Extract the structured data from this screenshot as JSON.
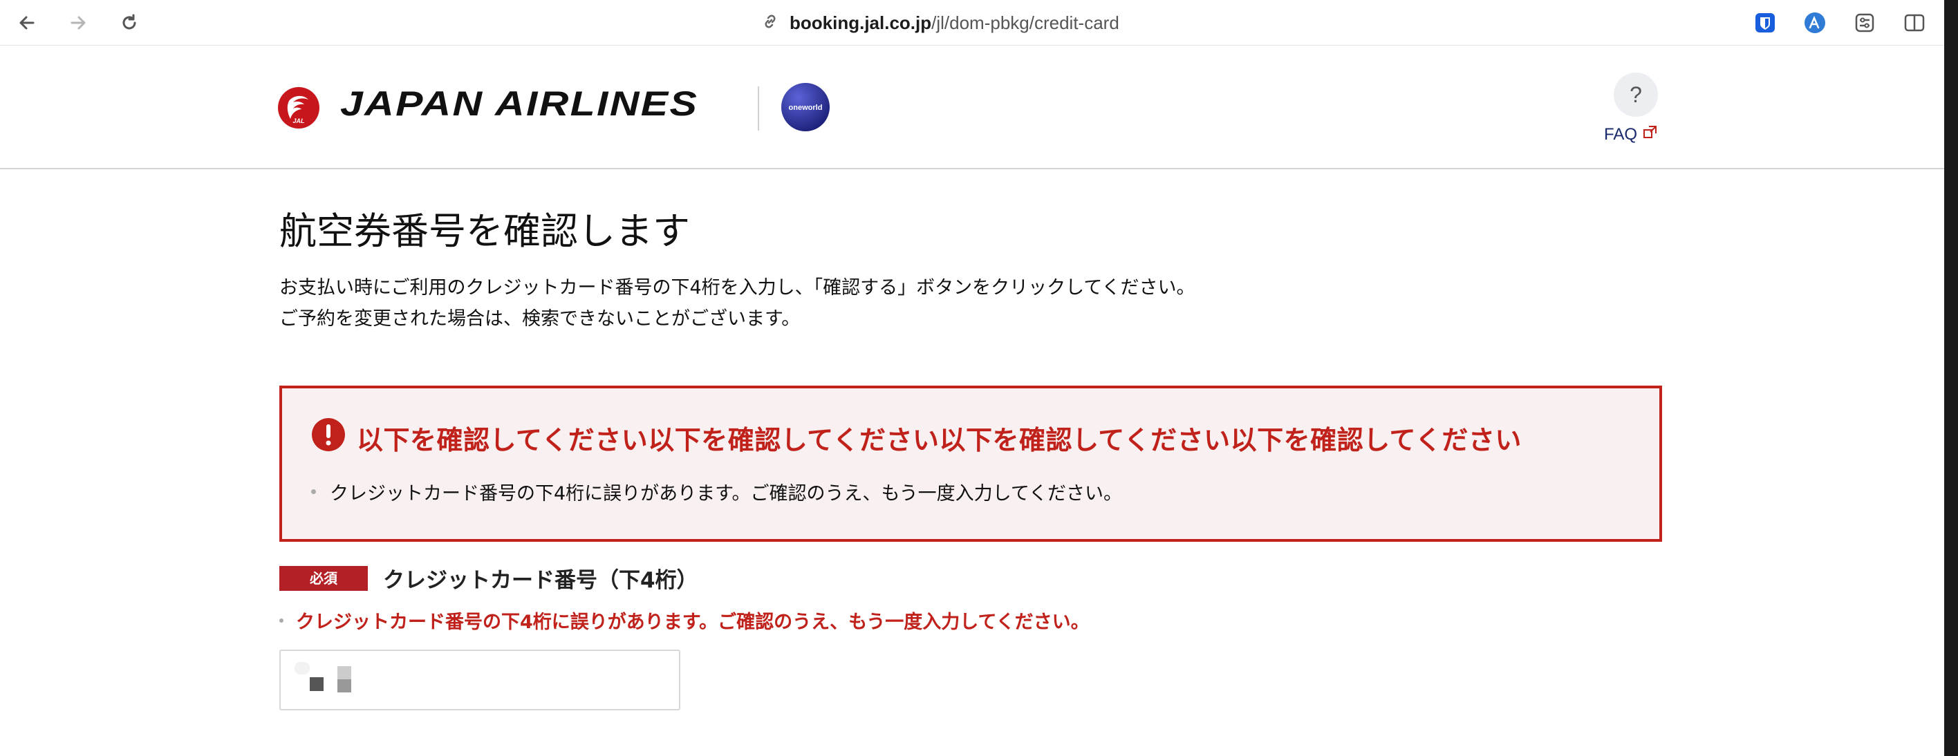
{
  "browser": {
    "url_host": "booking.jal.co.jp",
    "url_path": "/jl/dom-pbkg/credit-card",
    "icons": [
      "back-arrow-icon",
      "forward-arrow-icon",
      "reload-icon",
      "link-icon",
      "bitwarden-icon",
      "translate-icon",
      "settings-icon",
      "sidebar-icon"
    ]
  },
  "header": {
    "brand": "JAPAN AIRLINES",
    "crane_logo_text": "JAL",
    "alliance_logo_text": "oneworld",
    "help_label": "?",
    "faq_label": "FAQ"
  },
  "main": {
    "title": "航空券番号を確認します",
    "description_line1": "お支払い時にご利用のクレジットカード番号の下4桁を入力し、「確認する」ボタンをクリックしてください。",
    "description_line2": "ご予約を変更された場合は、検索できないことがございます。",
    "error_box": {
      "title": "以下を確認してください以下を確認してください以下を確認してください以下を確認してください",
      "items": [
        "クレジットカード番号の下4桁に誤りがあります。ご確認のうえ、もう一度入力してください。"
      ]
    },
    "field": {
      "required_badge": "必須",
      "label": "クレジットカード番号（下4桁）",
      "error": "クレジットカード番号の下4桁に誤りがあります。ご確認のうえ、もう一度入力してください。",
      "value": ""
    }
  },
  "colors": {
    "error_red": "#c0221b",
    "badge_red": "#b32025",
    "error_bg": "#f9f1f1",
    "faq_blue": "#1a2a6c",
    "oneworld_blue": "#2a2f8f"
  }
}
